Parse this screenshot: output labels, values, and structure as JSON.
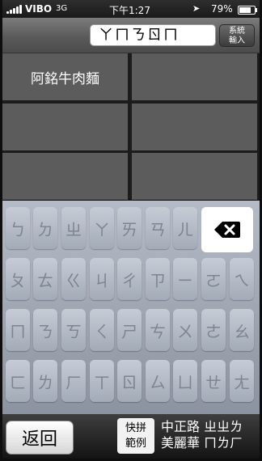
{
  "status_bar": {
    "carrier": "VIBO",
    "network": "3G",
    "time": "下午1:27",
    "location_icon": "location-arrow-icon",
    "battery_percent": "79%",
    "battery_level": 0.79
  },
  "top_bar": {
    "query": "ㄚㄇㄋㄖㄇ",
    "system_input_button": [
      "系統",
      "輸入"
    ]
  },
  "results": [
    "阿銘牛肉麵",
    "",
    "",
    "",
    "",
    ""
  ],
  "keyboard": {
    "rows": [
      [
        "ㄅ",
        "ㄉ",
        "ㄓ",
        "ㄚ",
        "ㄞ",
        "ㄢ",
        "ㄦ"
      ],
      [
        "ㄆ",
        "ㄊ",
        "ㄍ",
        "ㄐ",
        "ㄔ",
        "ㄗ",
        "ㄧ",
        "ㄛ",
        "ㄟ"
      ],
      [
        "ㄇ",
        "ㄋ",
        "ㄎ",
        "ㄑ",
        "ㄕ",
        "ㄘ",
        "ㄨ",
        "ㄜ",
        "ㄠ"
      ],
      [
        "ㄈ",
        "ㄌ",
        "ㄏ",
        "ㄒ",
        "ㄖ",
        "ㄙ",
        "ㄩ",
        "ㄝ",
        "ㄤ"
      ]
    ],
    "backspace_icon": "backspace-icon"
  },
  "bottom_bar": {
    "back_label": "返回",
    "example_button": [
      "快拼",
      "範例"
    ],
    "example_text": [
      "中正路 ㄓㄓㄌ",
      "美麗華 ㄇㄌㄏ"
    ]
  }
}
